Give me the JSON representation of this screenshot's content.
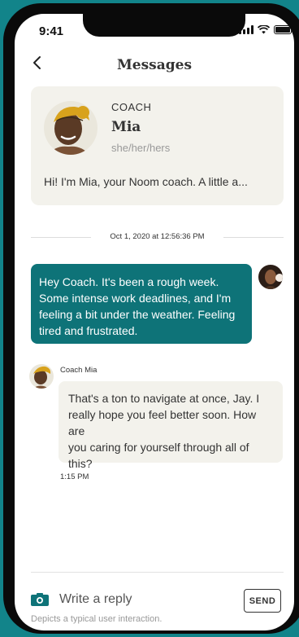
{
  "status_bar": {
    "time": "9:41"
  },
  "nav": {
    "title": "Messages"
  },
  "coach_card": {
    "role": "COACH",
    "name": "Mia",
    "pronouns": "she/her/hers",
    "preview": "Hi! I'm Mia, your Noom coach. A little a..."
  },
  "thread": {
    "date_divider": "Oct 1, 2020 at 12:56:36 PM",
    "outgoing": {
      "lines": [
        "Hey Coach. It's been a rough week.",
        "Some intense work deadlines, and I'm",
        "feeling a bit under the weather. Feeling",
        "tired and frustrated."
      ]
    },
    "incoming": {
      "sender": "Coach Mia",
      "lines": [
        "That's a ton to navigate at once, Jay. I",
        "really hope you feel better soon. How are",
        "you caring for yourself through all of",
        "this?"
      ],
      "time": "1:15 PM"
    }
  },
  "composer": {
    "placeholder": "Write a reply",
    "send_label": "SEND",
    "disclaimer": "Depicts a typical user interaction."
  },
  "colors": {
    "brand_teal": "#0e7378",
    "card_bg": "#f3f2ec",
    "page_bg": "#12848a"
  }
}
